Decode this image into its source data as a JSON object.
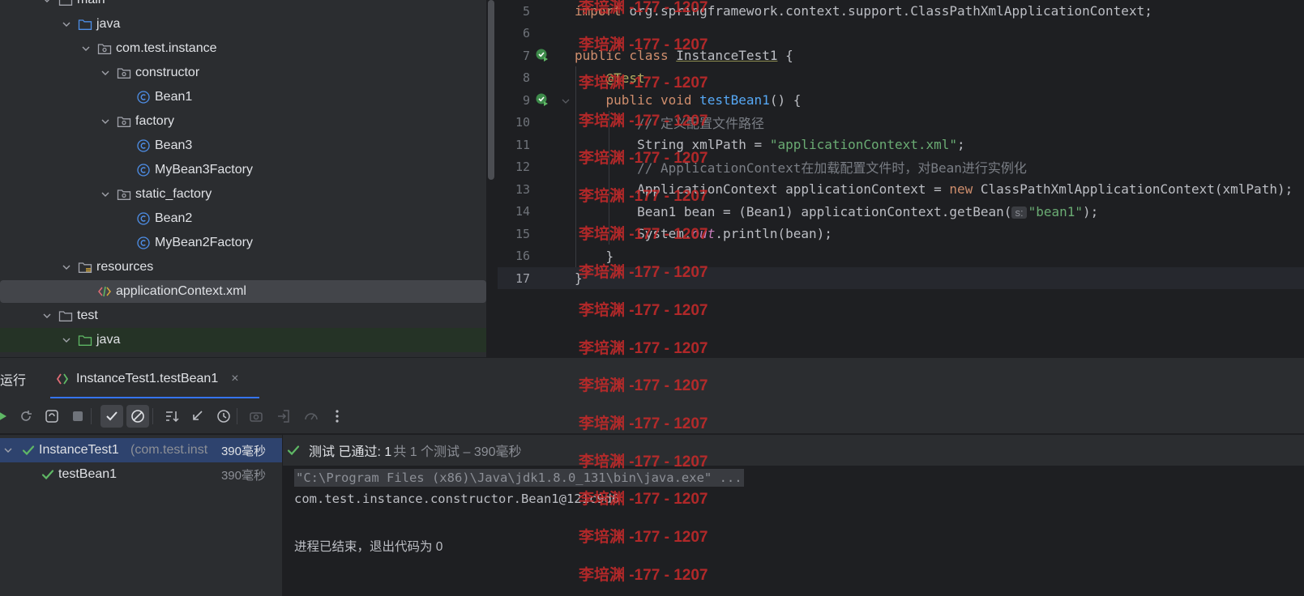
{
  "project_tree": {
    "items": [
      {
        "label": "main",
        "icon": "folder-icon"
      },
      {
        "label": "java",
        "icon": "source-folder-icon"
      },
      {
        "label": "com.test.instance",
        "icon": "package-icon"
      },
      {
        "label": "constructor",
        "icon": "package-icon"
      },
      {
        "label": "Bean1",
        "icon": "class-icon"
      },
      {
        "label": "factory",
        "icon": "package-icon"
      },
      {
        "label": "Bean3",
        "icon": "class-icon"
      },
      {
        "label": "MyBean3Factory",
        "icon": "class-icon"
      },
      {
        "label": "static_factory",
        "icon": "package-icon"
      },
      {
        "label": "Bean2",
        "icon": "class-icon"
      },
      {
        "label": "MyBean2Factory",
        "icon": "class-icon"
      },
      {
        "label": "resources",
        "icon": "resources-folder-icon"
      },
      {
        "label": "applicationContext.xml",
        "icon": "xml-file-icon"
      },
      {
        "label": "test",
        "icon": "folder-icon"
      },
      {
        "label": "java",
        "icon": "test-source-folder-icon"
      }
    ]
  },
  "editor": {
    "lines": [
      {
        "number": "5",
        "tokens": [
          {
            "t": "import ",
            "c": "kw"
          },
          {
            "t": "org.springframework.context.support.ClassPathXmlApplicationContext;",
            "c": ""
          }
        ]
      },
      {
        "number": "6",
        "tokens": []
      },
      {
        "number": "7",
        "tokens": [
          {
            "t": "public class ",
            "c": "kw"
          },
          {
            "t": "InstanceTest1",
            "c": "underline"
          },
          {
            "t": " {",
            "c": ""
          }
        ]
      },
      {
        "number": "8",
        "tokens": [
          {
            "t": "    ",
            "c": ""
          },
          {
            "t": "@Test",
            "c": "ann"
          }
        ]
      },
      {
        "number": "9",
        "tokens": [
          {
            "t": "    ",
            "c": ""
          },
          {
            "t": "public void ",
            "c": "kw"
          },
          {
            "t": "testBean1",
            "c": "fn"
          },
          {
            "t": "() {",
            "c": ""
          }
        ]
      },
      {
        "number": "10",
        "tokens": [
          {
            "t": "        ",
            "c": ""
          },
          {
            "t": "// 定义配置文件路径",
            "c": "cmt"
          }
        ]
      },
      {
        "number": "11",
        "tokens": [
          {
            "t": "        String xmlPath = ",
            "c": ""
          },
          {
            "t": "\"applicationContext.xml\"",
            "c": "str"
          },
          {
            "t": ";",
            "c": ""
          }
        ]
      },
      {
        "number": "12",
        "tokens": [
          {
            "t": "        ",
            "c": ""
          },
          {
            "t": "// ApplicationContext在加载配置文件时，对Bean进行实例化",
            "c": "cmt"
          }
        ]
      },
      {
        "number": "13",
        "tokens": [
          {
            "t": "        ApplicationContext applicationContext = ",
            "c": ""
          },
          {
            "t": "new ",
            "c": "kw"
          },
          {
            "t": "ClassPathXmlApplicationContext(xmlPath);",
            "c": ""
          }
        ]
      },
      {
        "number": "14",
        "tokens": [
          {
            "t": "        Bean1 bean = (Bean1) applicationContext.getBean(",
            "c": ""
          },
          {
            "t": "s:",
            "c": "hint"
          },
          {
            "t": "\"bean1\"",
            "c": "str"
          },
          {
            "t": ");",
            "c": ""
          }
        ]
      },
      {
        "number": "15",
        "tokens": [
          {
            "t": "        System.",
            "c": ""
          },
          {
            "t": "out",
            "c": "static-field"
          },
          {
            "t": ".println(bean);",
            "c": ""
          }
        ]
      },
      {
        "number": "16",
        "tokens": [
          {
            "t": "    }",
            "c": ""
          }
        ]
      },
      {
        "number": "17",
        "tokens": [
          {
            "t": "}",
            "c": ""
          }
        ]
      }
    ],
    "current_line": "17",
    "watermark": "李培渊 -177 - 1207"
  },
  "run_panel": {
    "title": "运行",
    "tab_label": "InstanceTest1.testBean1",
    "tab_close": "×",
    "toolbar_icons": [
      "rerun-icon",
      "rerun-failed-icon",
      "toggle-auto-test-icon",
      "stop-icon",
      "show-passed-icon",
      "show-ignored-icon",
      "sort-icon",
      "collapse-all-icon",
      "history-icon",
      "screenshot-icon",
      "import-tests-icon",
      "coverage-icon",
      "more-icon"
    ],
    "test_tree": [
      {
        "name": "InstanceTest1",
        "package": "(com.test.inst",
        "time": "390毫秒"
      },
      {
        "name": "testBean1",
        "package": "",
        "time": "390毫秒"
      }
    ],
    "status": {
      "passed": "测试 已通过: 1",
      "detail": "共 1 个测试 – 390毫秒"
    },
    "console": [
      "\"C:\\Program Files (x86)\\Java\\jdk1.8.0_131\\bin\\java.exe\" ...",
      "com.test.instance.constructor.Bean1@121c9d6",
      "",
      "进程已结束，退出代码为 0"
    ]
  },
  "colors": {
    "accent": "#3574f0",
    "passed": "#5fb865",
    "watermark": "#c62a2a"
  }
}
